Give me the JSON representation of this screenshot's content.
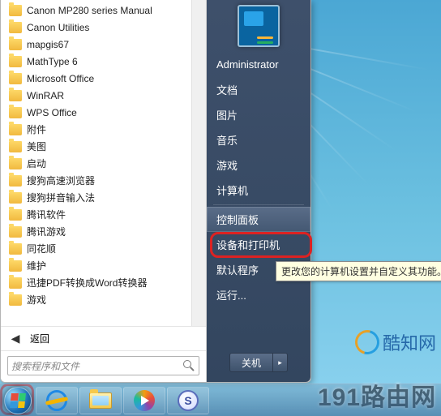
{
  "left_pane": {
    "programs": [
      "Canon MP280 series Manual",
      "Canon Utilities",
      "mapgis67",
      "MathType 6",
      "Microsoft Office",
      "WinRAR",
      "WPS Office",
      "附件",
      "美图",
      "启动",
      "搜狗高速浏览器",
      "搜狗拼音输入法",
      "腾讯软件",
      "腾讯游戏",
      "同花顺",
      "维护",
      "迅捷PDF转换成Word转换器",
      "游戏"
    ],
    "back_label": "返回",
    "search_placeholder": "搜索程序和文件"
  },
  "right_pane": {
    "username": "Administrator",
    "items": [
      "文档",
      "图片",
      "音乐",
      "游戏",
      "计算机"
    ],
    "items2": [
      "控制面板",
      "设备和打印机",
      "默认程序",
      "运行..."
    ],
    "selected_index": 0,
    "shutdown_label": "关机"
  },
  "tooltip": "更改您的计算机设置并自定义其功能。",
  "taskbar": {
    "buttons": [
      "start",
      "ie",
      "explorer",
      "wmp",
      "sogou"
    ]
  },
  "watermark1": "酷知网",
  "watermark2": "191路由网"
}
